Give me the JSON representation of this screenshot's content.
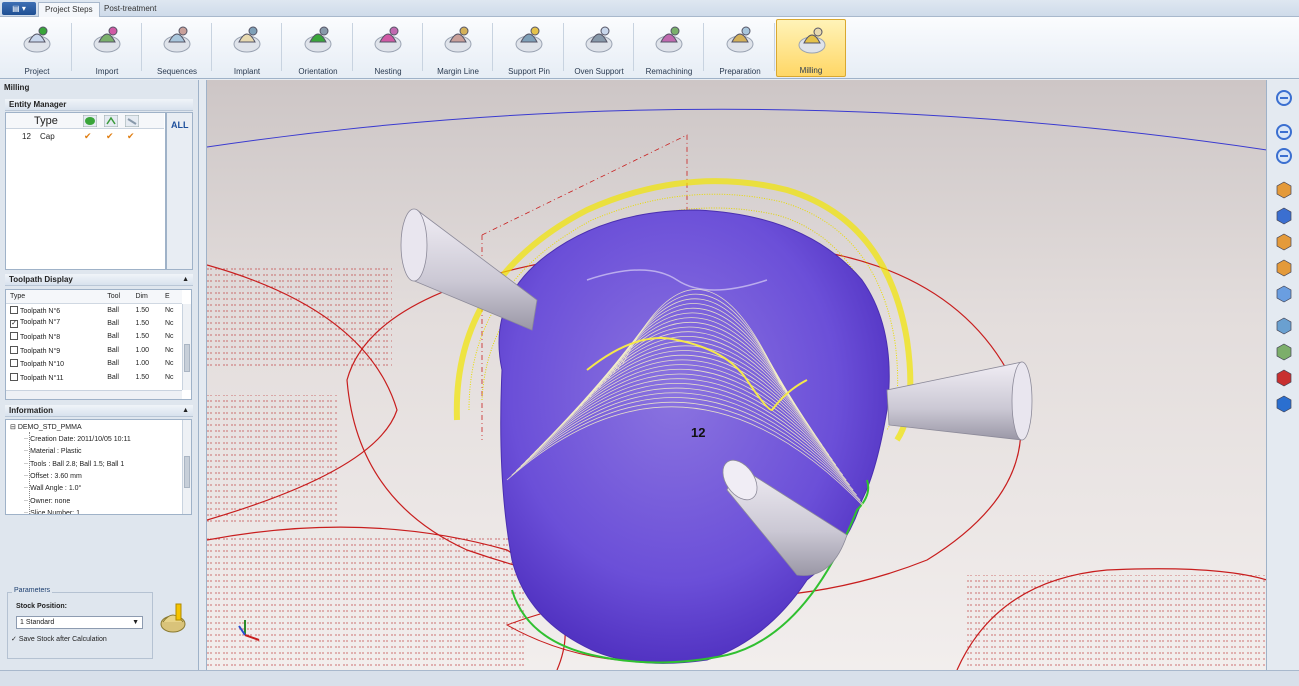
{
  "tabs": {
    "app_menu": "▤ ▾",
    "project_steps": "Project Steps",
    "post_treatment": "Post-treatment"
  },
  "ribbon": [
    {
      "label": "Project",
      "icon": "tooth-document-icon"
    },
    {
      "label": "Import",
      "icon": "import-icon"
    },
    {
      "label": "Sequences",
      "icon": "sequences-icon"
    },
    {
      "label": "Implant",
      "icon": "implant-icon"
    },
    {
      "label": "Orientation",
      "icon": "orientation-icon"
    },
    {
      "label": "Nesting",
      "icon": "nesting-icon"
    },
    {
      "label": "Margin Line",
      "icon": "margin-line-icon"
    },
    {
      "label": "Support Pin",
      "icon": "support-pin-icon"
    },
    {
      "label": "Oven Support",
      "icon": "oven-support-icon"
    },
    {
      "label": "Remachining",
      "icon": "remachining-icon"
    },
    {
      "label": "Preparation",
      "icon": "preparation-icon"
    },
    {
      "label": "Milling",
      "icon": "milling-icon",
      "active": true
    }
  ],
  "panel": {
    "title": "Milling",
    "entity_manager": {
      "title": "Entity Manager",
      "type_header": "Type",
      "all_label": "ALL",
      "rows": [
        {
          "id": "12",
          "type": "Cap"
        }
      ]
    },
    "toolpath": {
      "title": "Toolpath Display",
      "headers": {
        "type": "Type",
        "tool": "Tool",
        "dim": "Dim",
        "extra": "E"
      },
      "rows": [
        {
          "name": "Toolpath N°6",
          "tool": "Ball",
          "dim": "1.50",
          "extra": "Nc",
          "checked": false
        },
        {
          "name": "Toolpath N°7",
          "tool": "Ball",
          "dim": "1.50",
          "extra": "Nc",
          "checked": true
        },
        {
          "name": "Toolpath N°8",
          "tool": "Ball",
          "dim": "1.50",
          "extra": "Nc",
          "checked": false
        },
        {
          "name": "Toolpath N°9",
          "tool": "Ball",
          "dim": "1.00",
          "extra": "Nc",
          "checked": false
        },
        {
          "name": "Toolpath N°10",
          "tool": "Ball",
          "dim": "1.00",
          "extra": "Nc",
          "checked": false
        },
        {
          "name": "Toolpath N°11",
          "tool": "Ball",
          "dim": "1.50",
          "extra": "Nc",
          "checked": false
        }
      ]
    },
    "information": {
      "title": "Information",
      "root": "DEMO_STD_PMMA",
      "lines": [
        "Creation Date: 2011/10/05 10:11",
        "Material : Plastic",
        "Tools : Ball 2.8; Ball 1.5; Ball 1",
        "Offset : 3.60 mm",
        "Wall Angle : 1.0°",
        "Owner: none",
        "Slice Number: 1"
      ]
    },
    "parameters": {
      "legend": "Parameters",
      "stock_label": "Stock Position:",
      "stock_value": "1 Standard",
      "save_label": "Save Stock after Calculation"
    }
  },
  "viewport": {
    "entity_label": "12"
  },
  "right_tools": [
    "zoom-window-icon",
    "zoom-in-icon",
    "zoom-out-icon",
    "cube-view-icon",
    "axis-view-icon",
    "top-view-icon",
    "front-view-icon",
    "side-view-icon",
    "fixture-green-icon",
    "fixture-red-icon",
    "disc-icon",
    "ring-icon"
  ]
}
